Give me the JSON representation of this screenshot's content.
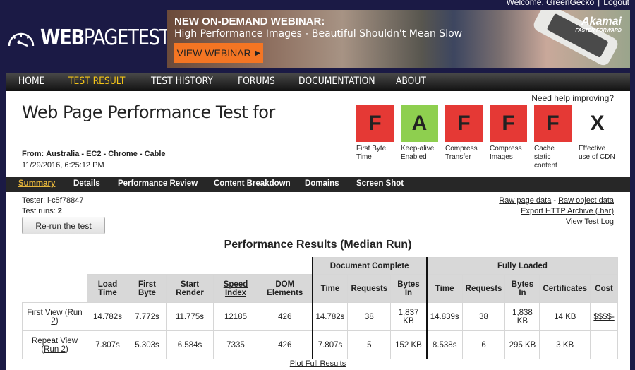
{
  "header": {
    "welcome_text": "Welcome, GreenGecko",
    "separator": "|",
    "logout_label": "Logout",
    "logo_bold": "WEB",
    "logo_light": "PAGETEST"
  },
  "banner": {
    "title": "NEW ON-DEMAND WEBINAR:",
    "subtitle": "High Performance Images  -  Beautiful Shouldn't Mean Slow",
    "button_label": "VIEW WEBINAR",
    "button_icon": "play-triangle-icon",
    "sponsor": "Akamai",
    "sponsor_tagline": "FASTER FORWARD",
    "button_color": "#f47523"
  },
  "nav": {
    "items": [
      {
        "label": "HOME",
        "active": false
      },
      {
        "label": "TEST RESULT",
        "active": true
      },
      {
        "label": "TEST HISTORY",
        "active": false
      },
      {
        "label": "FORUMS",
        "active": false
      },
      {
        "label": "DOCUMENTATION",
        "active": false
      },
      {
        "label": "ABOUT",
        "active": false
      }
    ]
  },
  "test": {
    "title": "Web Page Performance Test for",
    "from_label": "From:",
    "from_value": "Australia - EC2 - Chrome - Cable",
    "datetime": "11/29/2016, 6:25:12 PM",
    "help_link": "Need help improving?"
  },
  "grades": [
    {
      "grade": "F",
      "label": "First Byte Time",
      "color": "#e53935"
    },
    {
      "grade": "A",
      "label": "Keep-alive Enabled",
      "color": "#8ecf4f"
    },
    {
      "grade": "F",
      "label": "Compress Transfer",
      "color": "#e53935"
    },
    {
      "grade": "F",
      "label": "Compress Images",
      "color": "#e53935"
    },
    {
      "grade": "F",
      "label": "Cache static content",
      "color": "#e53935"
    },
    {
      "grade": "X",
      "label": "Effective use of CDN",
      "color": "none"
    }
  ],
  "subnav": {
    "items": [
      {
        "label": "Summary",
        "active": true
      },
      {
        "label": "Details",
        "active": false
      },
      {
        "label": "Performance Review",
        "active": false
      },
      {
        "label": "Content Breakdown",
        "active": false
      },
      {
        "label": "Domains",
        "active": false
      },
      {
        "label": "Screen Shot",
        "active": false
      }
    ]
  },
  "info": {
    "tester_label": "Tester:",
    "tester_value": "i-c5f78847",
    "runs_label": "Test runs:",
    "runs_value": "2",
    "rerun_button": "Re-run the test",
    "raw_page_data": "Raw page data",
    "dash": "-",
    "raw_object_data": "Raw object data",
    "export_har": "Export HTTP Archive (.har)",
    "view_log": "View Test Log"
  },
  "results": {
    "title": "Performance Results (Median Run)",
    "group_headers": {
      "document_complete": "Document Complete",
      "fully_loaded": "Fully Loaded"
    },
    "columns": {
      "load_time": "Load Time",
      "first_byte": "First Byte",
      "start_render": "Start Render",
      "speed_index": "Speed Index",
      "dom_elements": "DOM Elements",
      "dc_time": "Time",
      "dc_requests": "Requests",
      "dc_bytes": "Bytes In",
      "fl_time": "Time",
      "fl_requests": "Requests",
      "fl_bytes": "Bytes In",
      "certificates": "Certificates",
      "cost": "Cost"
    },
    "rows": [
      {
        "label": "First View (",
        "run_link": "Run 2",
        "label_end": ")",
        "load_time": "14.782s",
        "first_byte": "7.772s",
        "start_render": "11.775s",
        "speed_index": "12185",
        "dom_elements": "426",
        "dc_time": "14.782s",
        "dc_requests": "38",
        "dc_bytes": "1,837 KB",
        "fl_time": "14.839s",
        "fl_requests": "38",
        "fl_bytes": "1,838 KB",
        "certificates": "14 KB",
        "cost": "$$$$-"
      },
      {
        "label": "Repeat View (",
        "run_link": "Run 2",
        "label_end": ")",
        "load_time": "7.807s",
        "first_byte": "5.303s",
        "start_render": "6.584s",
        "speed_index": "7335",
        "dom_elements": "426",
        "dc_time": "7.807s",
        "dc_requests": "5",
        "dc_bytes": "152 KB",
        "fl_time": "8.538s",
        "fl_requests": "6",
        "fl_bytes": "295 KB",
        "certificates": "3 KB",
        "cost": ""
      }
    ],
    "plot_link": "Plot Full Results"
  }
}
